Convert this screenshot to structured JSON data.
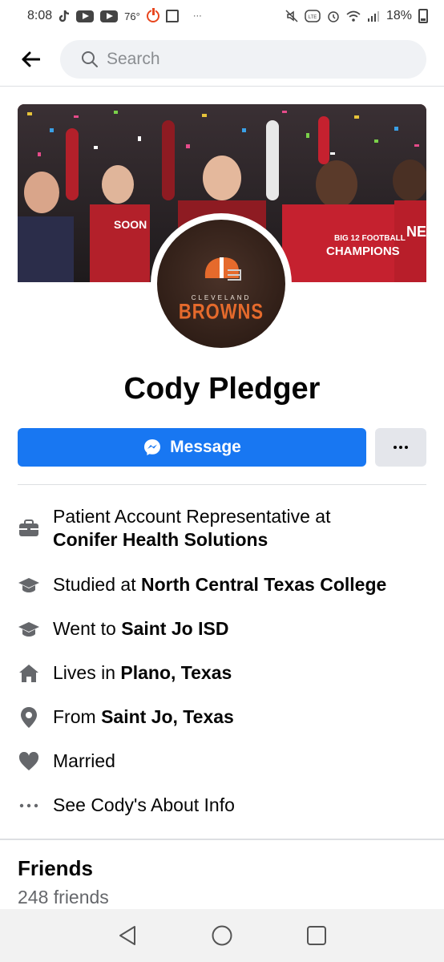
{
  "status_bar": {
    "time": "8:08",
    "temperature": "76°",
    "battery": "18%",
    "icons": [
      "tiktok-icon",
      "youtube-icon",
      "youtube-icon",
      "power-icon",
      "twitch-icon",
      "more-icon",
      "mute-icon",
      "volte-icon",
      "alarm-icon",
      "wifi-icon",
      "signal-icon",
      "battery-icon"
    ]
  },
  "header": {
    "search_placeholder": "Search"
  },
  "profile": {
    "name": "Cody Pledger",
    "avatar_logo": {
      "city": "CLEVELAND",
      "team": "BROWNS"
    },
    "message_label": "Message"
  },
  "about": [
    {
      "icon": "briefcase-icon",
      "prefix": "Patient Account Representative at",
      "bold": "Conifer Health Solutions"
    },
    {
      "icon": "graduation-cap-icon",
      "prefix": "Studied at ",
      "bold": "North Central Texas College"
    },
    {
      "icon": "graduation-cap-icon",
      "prefix": "Went to ",
      "bold": "Saint Jo ISD"
    },
    {
      "icon": "house-icon",
      "prefix": "Lives in ",
      "bold": "Plano, Texas"
    },
    {
      "icon": "location-pin-icon",
      "prefix": "From ",
      "bold": "Saint Jo, Texas"
    },
    {
      "icon": "heart-icon",
      "prefix": "Married",
      "bold": ""
    },
    {
      "icon": "ellipsis-icon",
      "prefix": "See Cody's About Info",
      "bold": ""
    }
  ],
  "friends": {
    "title": "Friends",
    "count": "248 friends"
  },
  "colors": {
    "accent": "#1877f2",
    "secondary_button": "#e4e6eb",
    "icon_gray": "#65676b",
    "text": "#050505"
  }
}
